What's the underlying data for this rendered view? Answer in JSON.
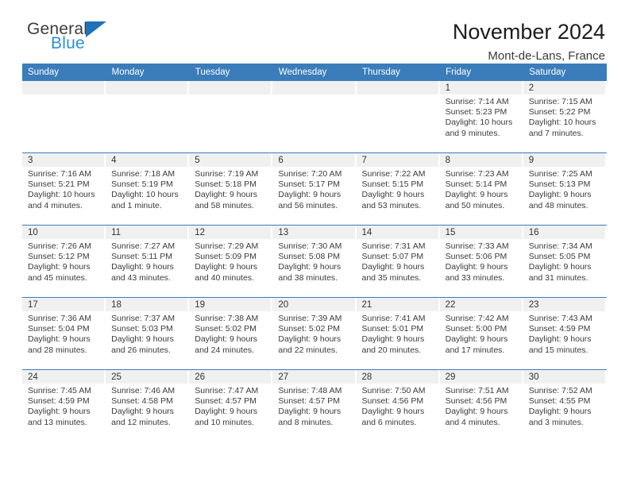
{
  "brand": {
    "name_top": "General",
    "name_bottom": "Blue",
    "triangle_color": "#1d72b8",
    "text_color": "#3c3c3c",
    "blue_text_color": "#2a90d8"
  },
  "header": {
    "title": "November 2024",
    "subtitle": "Mont-de-Lans, France"
  },
  "theme": {
    "header_bg": "#3b7cba",
    "header_text": "#ffffff",
    "daynum_bg": "#f0f0f0",
    "grid_line": "#3b7cba",
    "body_text": "#3b3b3b"
  },
  "weekdays": [
    "Sunday",
    "Monday",
    "Tuesday",
    "Wednesday",
    "Thursday",
    "Friday",
    "Saturday"
  ],
  "labels": {
    "sunrise_prefix": "Sunrise:",
    "sunset_prefix": "Sunset:",
    "daylight_prefix": "Daylight:"
  },
  "weeks": [
    [
      {
        "day": "",
        "sunrise": "",
        "sunset": "",
        "daylight": "",
        "empty": true
      },
      {
        "day": "",
        "sunrise": "",
        "sunset": "",
        "daylight": "",
        "empty": true
      },
      {
        "day": "",
        "sunrise": "",
        "sunset": "",
        "daylight": "",
        "empty": true
      },
      {
        "day": "",
        "sunrise": "",
        "sunset": "",
        "daylight": "",
        "empty": true
      },
      {
        "day": "",
        "sunrise": "",
        "sunset": "",
        "daylight": "",
        "empty": true
      },
      {
        "day": "1",
        "sunrise": "Sunrise: 7:14 AM",
        "sunset": "Sunset: 5:23 PM",
        "daylight": "Daylight: 10 hours and 9 minutes.",
        "empty": false
      },
      {
        "day": "2",
        "sunrise": "Sunrise: 7:15 AM",
        "sunset": "Sunset: 5:22 PM",
        "daylight": "Daylight: 10 hours and 7 minutes.",
        "empty": false
      }
    ],
    [
      {
        "day": "3",
        "sunrise": "Sunrise: 7:16 AM",
        "sunset": "Sunset: 5:21 PM",
        "daylight": "Daylight: 10 hours and 4 minutes.",
        "empty": false
      },
      {
        "day": "4",
        "sunrise": "Sunrise: 7:18 AM",
        "sunset": "Sunset: 5:19 PM",
        "daylight": "Daylight: 10 hours and 1 minute.",
        "empty": false
      },
      {
        "day": "5",
        "sunrise": "Sunrise: 7:19 AM",
        "sunset": "Sunset: 5:18 PM",
        "daylight": "Daylight: 9 hours and 58 minutes.",
        "empty": false
      },
      {
        "day": "6",
        "sunrise": "Sunrise: 7:20 AM",
        "sunset": "Sunset: 5:17 PM",
        "daylight": "Daylight: 9 hours and 56 minutes.",
        "empty": false
      },
      {
        "day": "7",
        "sunrise": "Sunrise: 7:22 AM",
        "sunset": "Sunset: 5:15 PM",
        "daylight": "Daylight: 9 hours and 53 minutes.",
        "empty": false
      },
      {
        "day": "8",
        "sunrise": "Sunrise: 7:23 AM",
        "sunset": "Sunset: 5:14 PM",
        "daylight": "Daylight: 9 hours and 50 minutes.",
        "empty": false
      },
      {
        "day": "9",
        "sunrise": "Sunrise: 7:25 AM",
        "sunset": "Sunset: 5:13 PM",
        "daylight": "Daylight: 9 hours and 48 minutes.",
        "empty": false
      }
    ],
    [
      {
        "day": "10",
        "sunrise": "Sunrise: 7:26 AM",
        "sunset": "Sunset: 5:12 PM",
        "daylight": "Daylight: 9 hours and 45 minutes.",
        "empty": false
      },
      {
        "day": "11",
        "sunrise": "Sunrise: 7:27 AM",
        "sunset": "Sunset: 5:11 PM",
        "daylight": "Daylight: 9 hours and 43 minutes.",
        "empty": false
      },
      {
        "day": "12",
        "sunrise": "Sunrise: 7:29 AM",
        "sunset": "Sunset: 5:09 PM",
        "daylight": "Daylight: 9 hours and 40 minutes.",
        "empty": false
      },
      {
        "day": "13",
        "sunrise": "Sunrise: 7:30 AM",
        "sunset": "Sunset: 5:08 PM",
        "daylight": "Daylight: 9 hours and 38 minutes.",
        "empty": false
      },
      {
        "day": "14",
        "sunrise": "Sunrise: 7:31 AM",
        "sunset": "Sunset: 5:07 PM",
        "daylight": "Daylight: 9 hours and 35 minutes.",
        "empty": false
      },
      {
        "day": "15",
        "sunrise": "Sunrise: 7:33 AM",
        "sunset": "Sunset: 5:06 PM",
        "daylight": "Daylight: 9 hours and 33 minutes.",
        "empty": false
      },
      {
        "day": "16",
        "sunrise": "Sunrise: 7:34 AM",
        "sunset": "Sunset: 5:05 PM",
        "daylight": "Daylight: 9 hours and 31 minutes.",
        "empty": false
      }
    ],
    [
      {
        "day": "17",
        "sunrise": "Sunrise: 7:36 AM",
        "sunset": "Sunset: 5:04 PM",
        "daylight": "Daylight: 9 hours and 28 minutes.",
        "empty": false
      },
      {
        "day": "18",
        "sunrise": "Sunrise: 7:37 AM",
        "sunset": "Sunset: 5:03 PM",
        "daylight": "Daylight: 9 hours and 26 minutes.",
        "empty": false
      },
      {
        "day": "19",
        "sunrise": "Sunrise: 7:38 AM",
        "sunset": "Sunset: 5:02 PM",
        "daylight": "Daylight: 9 hours and 24 minutes.",
        "empty": false
      },
      {
        "day": "20",
        "sunrise": "Sunrise: 7:39 AM",
        "sunset": "Sunset: 5:02 PM",
        "daylight": "Daylight: 9 hours and 22 minutes.",
        "empty": false
      },
      {
        "day": "21",
        "sunrise": "Sunrise: 7:41 AM",
        "sunset": "Sunset: 5:01 PM",
        "daylight": "Daylight: 9 hours and 20 minutes.",
        "empty": false
      },
      {
        "day": "22",
        "sunrise": "Sunrise: 7:42 AM",
        "sunset": "Sunset: 5:00 PM",
        "daylight": "Daylight: 9 hours and 17 minutes.",
        "empty": false
      },
      {
        "day": "23",
        "sunrise": "Sunrise: 7:43 AM",
        "sunset": "Sunset: 4:59 PM",
        "daylight": "Daylight: 9 hours and 15 minutes.",
        "empty": false
      }
    ],
    [
      {
        "day": "24",
        "sunrise": "Sunrise: 7:45 AM",
        "sunset": "Sunset: 4:59 PM",
        "daylight": "Daylight: 9 hours and 13 minutes.",
        "empty": false
      },
      {
        "day": "25",
        "sunrise": "Sunrise: 7:46 AM",
        "sunset": "Sunset: 4:58 PM",
        "daylight": "Daylight: 9 hours and 12 minutes.",
        "empty": false
      },
      {
        "day": "26",
        "sunrise": "Sunrise: 7:47 AM",
        "sunset": "Sunset: 4:57 PM",
        "daylight": "Daylight: 9 hours and 10 minutes.",
        "empty": false
      },
      {
        "day": "27",
        "sunrise": "Sunrise: 7:48 AM",
        "sunset": "Sunset: 4:57 PM",
        "daylight": "Daylight: 9 hours and 8 minutes.",
        "empty": false
      },
      {
        "day": "28",
        "sunrise": "Sunrise: 7:50 AM",
        "sunset": "Sunset: 4:56 PM",
        "daylight": "Daylight: 9 hours and 6 minutes.",
        "empty": false
      },
      {
        "day": "29",
        "sunrise": "Sunrise: 7:51 AM",
        "sunset": "Sunset: 4:56 PM",
        "daylight": "Daylight: 9 hours and 4 minutes.",
        "empty": false
      },
      {
        "day": "30",
        "sunrise": "Sunrise: 7:52 AM",
        "sunset": "Sunset: 4:55 PM",
        "daylight": "Daylight: 9 hours and 3 minutes.",
        "empty": false
      }
    ]
  ]
}
